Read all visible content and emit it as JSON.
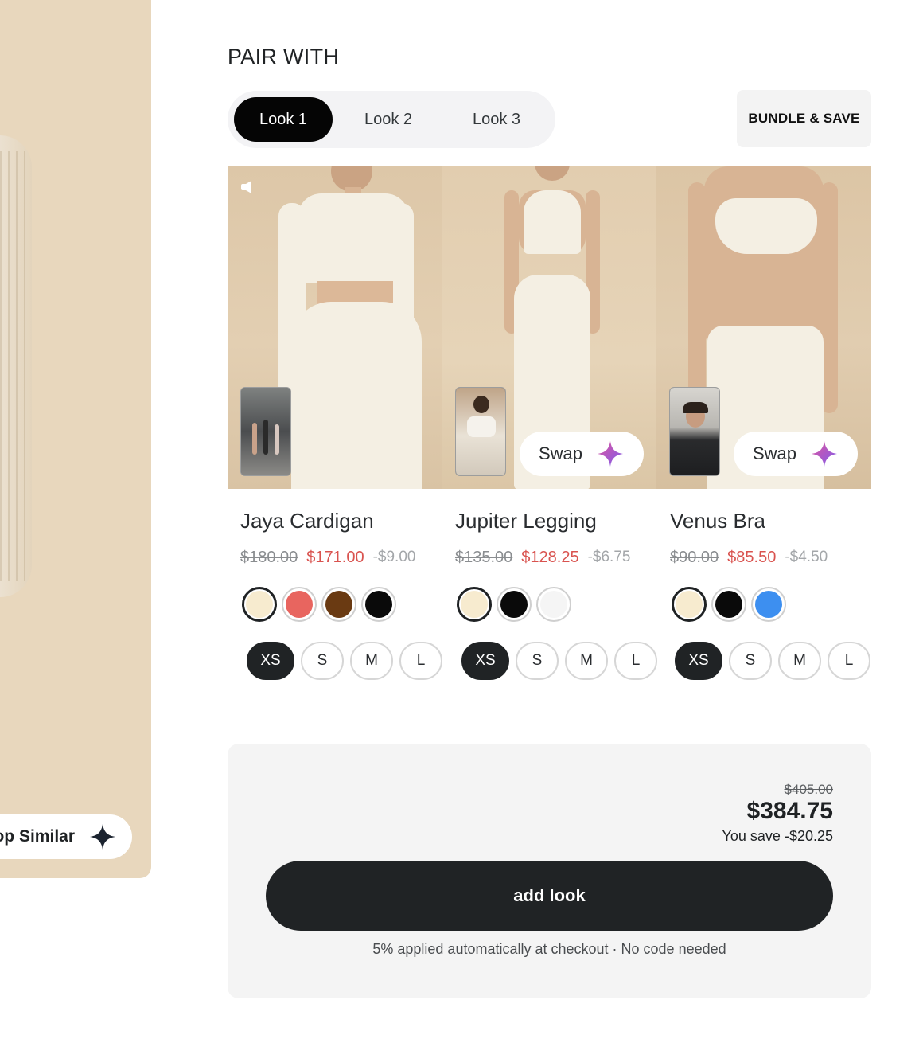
{
  "hero": {
    "shop_similar_label": "Shop Similar"
  },
  "section": {
    "title": "PAIR WITH"
  },
  "looks": {
    "tabs": [
      "Look 1",
      "Look 2",
      "Look 3"
    ],
    "active_tab": "Look 1",
    "bundle_label": "BUNDLE & SAVE"
  },
  "products": [
    {
      "name": "Jaya Cardigan",
      "price_old": "$180.00",
      "price_new": "$171.00",
      "discount": "-$9.00",
      "swatches": [
        "#f7ebcf",
        "#e8655f",
        "#6a3a12",
        "#0a0a0a"
      ],
      "selected_swatch": 0,
      "sizes": [
        "XS",
        "S",
        "M",
        "L"
      ],
      "selected_size": "XS",
      "has_swap": false
    },
    {
      "name": "Jupiter Legging",
      "price_old": "$135.00",
      "price_new": "$128.25",
      "discount": "-$6.75",
      "swatches": [
        "#f7ebcf",
        "#0a0a0a",
        "#f5f5f5"
      ],
      "selected_swatch": 0,
      "sizes": [
        "XS",
        "S",
        "M",
        "L"
      ],
      "selected_size": "XS",
      "has_swap": true,
      "swap_label": "Swap"
    },
    {
      "name": "Venus Bra",
      "price_old": "$90.00",
      "price_new": "$85.50",
      "discount": "-$4.50",
      "swatches": [
        "#f7ebcf",
        "#0a0a0a",
        "#3d8ff0"
      ],
      "selected_swatch": 0,
      "sizes": [
        "XS",
        "S",
        "M",
        "L"
      ],
      "selected_size": "XS",
      "has_swap": true,
      "swap_label": "Swap"
    }
  ],
  "summary": {
    "original_total": "$405.00",
    "total": "$384.75",
    "savings": "You save -$20.25",
    "cta_label": "add look",
    "note": "5% applied automatically at checkout · No code needed"
  },
  "colors": {
    "accent_dark": "#202325",
    "sale_red": "#d9534f",
    "sparkle_gradient": [
      "#e0559c",
      "#7b5cf0"
    ]
  }
}
